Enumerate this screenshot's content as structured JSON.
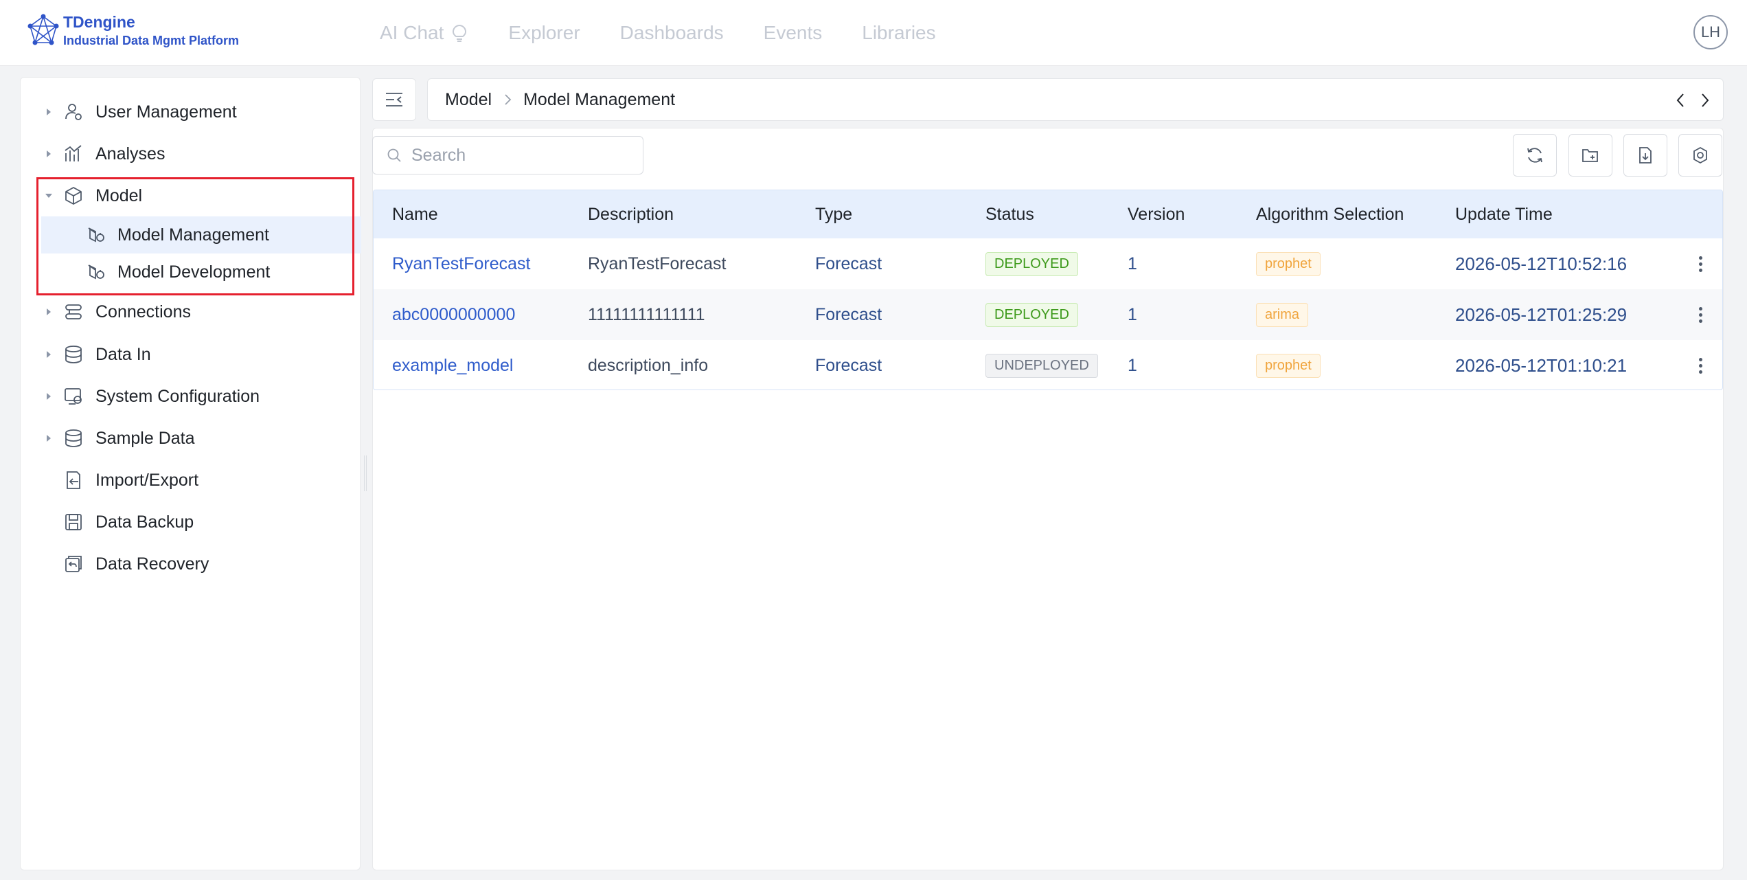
{
  "brand": {
    "name": "TDengine",
    "subtitle": "Industrial Data Mgmt Platform"
  },
  "topnav": [
    {
      "label": "AI Chat",
      "icon": "lightbulb-icon"
    },
    {
      "label": "Explorer"
    },
    {
      "label": "Dashboards"
    },
    {
      "label": "Events"
    },
    {
      "label": "Libraries"
    }
  ],
  "user": {
    "initials": "LH"
  },
  "sidebar": {
    "items": [
      {
        "label": "User Management",
        "icon": "user-gear-icon",
        "expandable": true
      },
      {
        "label": "Analyses",
        "icon": "analytics-icon",
        "expandable": true
      },
      {
        "label": "Model",
        "icon": "cube-icon",
        "expandable": true,
        "expanded": true,
        "children": [
          {
            "label": "Model Management",
            "icon": "model-icon",
            "active": true
          },
          {
            "label": "Model Development",
            "icon": "model-icon"
          }
        ]
      },
      {
        "label": "Connections",
        "icon": "connections-icon",
        "expandable": true
      },
      {
        "label": "Data In",
        "icon": "database-in-icon",
        "expandable": true
      },
      {
        "label": "System Configuration",
        "icon": "system-config-icon",
        "expandable": true
      },
      {
        "label": "Sample Data",
        "icon": "database-icon",
        "expandable": true
      },
      {
        "label": "Import/Export",
        "icon": "import-export-icon"
      },
      {
        "label": "Data Backup",
        "icon": "backup-icon"
      },
      {
        "label": "Data Recovery",
        "icon": "recovery-icon"
      }
    ]
  },
  "breadcrumb": [
    "Model",
    "Model Management"
  ],
  "search": {
    "placeholder": "Search",
    "value": ""
  },
  "toolbar": [
    "refresh-icon",
    "new-folder-icon",
    "export-file-icon",
    "settings-icon"
  ],
  "table": {
    "columns": [
      "Name",
      "Description",
      "Type",
      "Status",
      "Version",
      "Algorithm Selection",
      "Update Time"
    ],
    "rows": [
      {
        "name": "RyanTestForecast",
        "description": "RyanTestForecast",
        "type": "Forecast",
        "status": "DEPLOYED",
        "version": "1",
        "algorithm": "prophet",
        "update_time": "2026-05-12T10:52:16"
      },
      {
        "name": "abc0000000000",
        "description": "11111111111111",
        "type": "Forecast",
        "status": "DEPLOYED",
        "version": "1",
        "algorithm": "arima",
        "update_time": "2026-05-12T01:25:29"
      },
      {
        "name": "example_model",
        "description": "description_info",
        "type": "Forecast",
        "status": "UNDEPLOYED",
        "version": "1",
        "algorithm": "prophet",
        "update_time": "2026-05-12T01:10:21"
      }
    ]
  },
  "colors": {
    "brand": "#2f54c8",
    "link": "#2f5ccb",
    "highlight": "#e5202e",
    "active_bg": "#eaf1fd",
    "header_bg": "#e6effd"
  }
}
